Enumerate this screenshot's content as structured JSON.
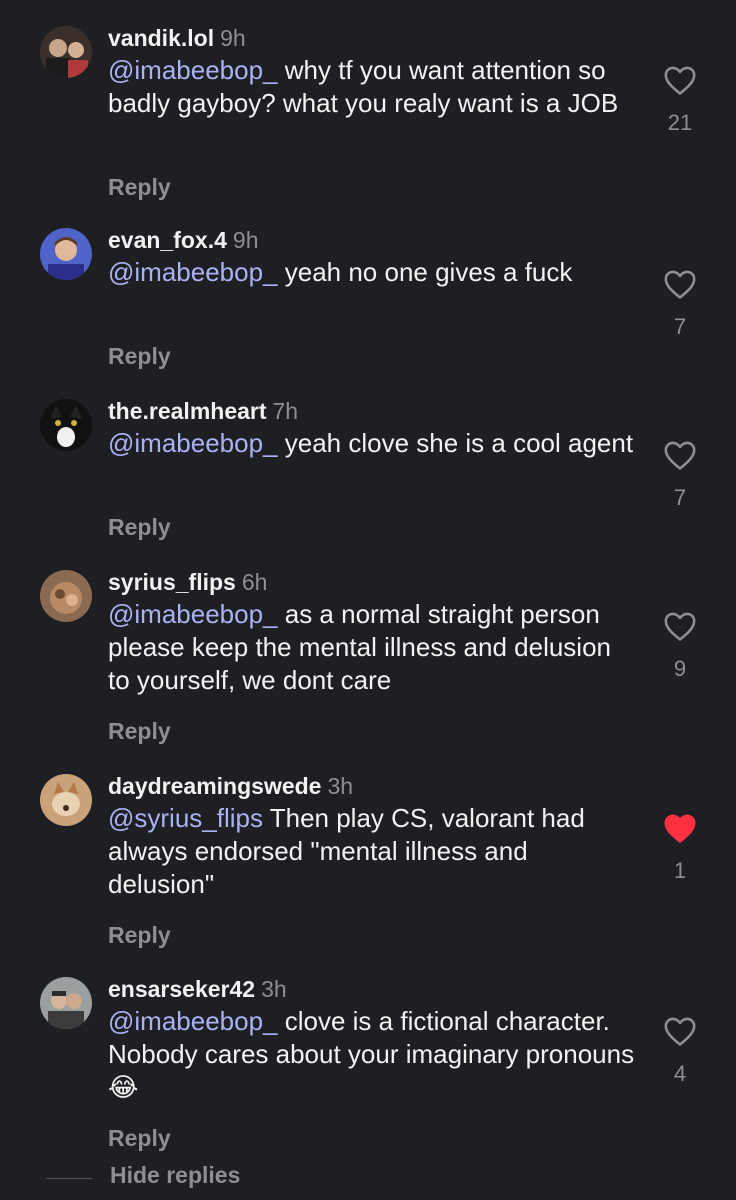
{
  "comments": [
    {
      "username": "vandik.lol",
      "time": "9h",
      "mention": "@imabeebop_",
      "text": " why tf you want attention so badly gayboy? what you realy want is a JOB",
      "reply_label": "Reply",
      "likes": "21",
      "liked": false,
      "avatar_color": "#3a2f2a"
    },
    {
      "username": "evan_fox.4",
      "time": "9h",
      "mention": "@imabeebop_",
      "text": " yeah no one gives a fuck",
      "reply_label": "Reply",
      "likes": "7",
      "liked": false,
      "avatar_color": "#4f63c9"
    },
    {
      "username": "the.realmheart",
      "time": "7h",
      "mention": "@imabeebop_",
      "text": " yeah clove she is a cool agent",
      "reply_label": "Reply",
      "likes": "7",
      "liked": false,
      "avatar_color": "#111111"
    },
    {
      "username": "syrius_flips",
      "time": "6h",
      "mention": "@imabeebop_",
      "text": " as a normal straight person please keep the mental illness and delusion to yourself, we dont care",
      "reply_label": "Reply",
      "likes": "9",
      "liked": false,
      "avatar_color": "#8a6a50"
    },
    {
      "username": "daydreamingswede",
      "time": "3h",
      "mention": "@syrius_flips",
      "text": " Then play CS, valorant had always endorsed \"mental illness and delusion\"",
      "reply_label": "Reply",
      "likes": "1",
      "liked": true,
      "avatar_color": "#c9a27a"
    },
    {
      "username": "ensarseker42",
      "time": "3h",
      "mention": "@imabeebop_",
      "text": " clove is a fictional character. Nobody cares about your imaginary pronouns",
      "emoji": "😂",
      "reply_label": "Reply",
      "likes": "4",
      "liked": false,
      "avatar_color": "#9aa0a0"
    }
  ],
  "hide_replies_label": "Hide replies",
  "colors": {
    "background": "#1e1f23",
    "mention": "#a9b2f3",
    "muted": "#8e8e93",
    "heart_liked": "#ff3040"
  }
}
